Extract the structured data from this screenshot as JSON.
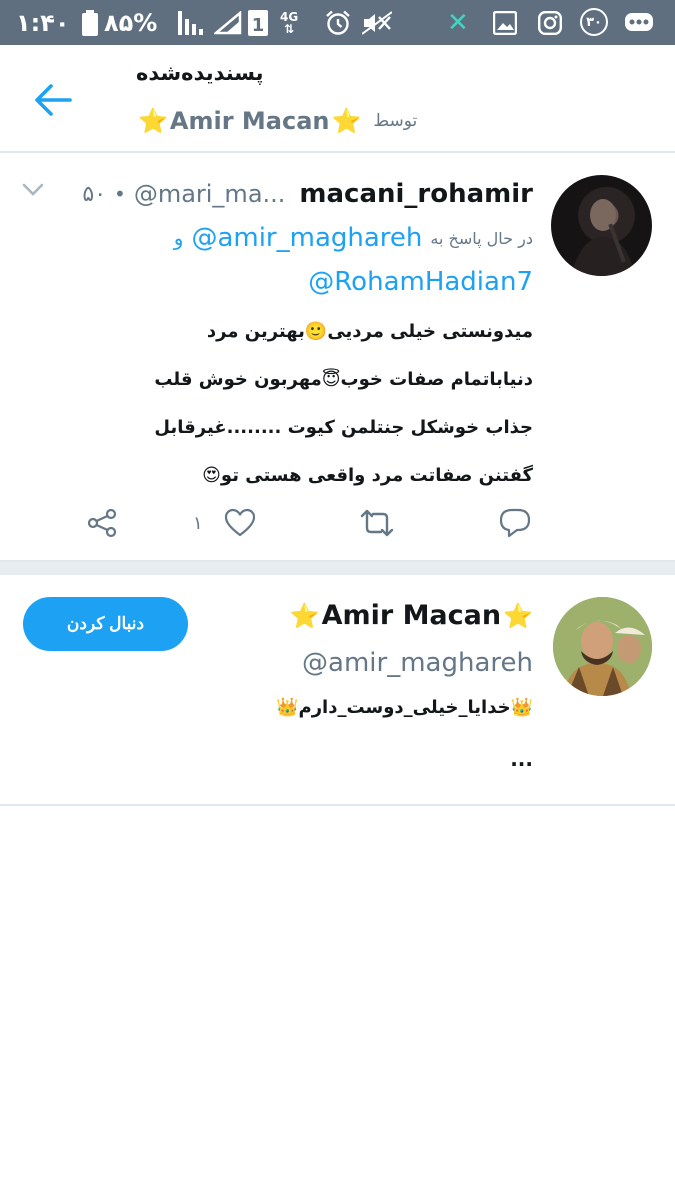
{
  "status_bar": {
    "time": "۱:۴۰",
    "battery": "۸۵%",
    "network": "4G",
    "sim": "1",
    "notification_count": "۳۰"
  },
  "header": {
    "title": "پسندیده‌شده",
    "by_label": "توسط",
    "owner_name": "Amir Macan"
  },
  "tweet": {
    "display_name": "macani_rohamir",
    "handle": "@mari_ma...",
    "time": "۵۰",
    "separator": "•",
    "replying_label": "در حال پاسخ به",
    "reply_to_1": "@amir_maghareh",
    "reply_and": "و",
    "reply_to_2": "@RohamHadian7",
    "body_lines": [
      "میدونستی خیلی مردیی🙂بهترین مرد",
      "دنیاباتمام صفات خوب😇مهربون خوش قلب",
      "جذاب خوشکل جنتلمن کیوت ........غیرقابل",
      "گفتنن صفاتت مرد واقعی هستی تو😍"
    ],
    "like_count": "۱"
  },
  "user_card": {
    "name": "Amir Macan",
    "handle": "@amir_maghareh",
    "bio": "👑خدایا_خیلی_دوست_دارم👑",
    "bio_more": "...",
    "follow_label": "دنبال کردن"
  },
  "colors": {
    "accent": "#1da1f2",
    "status_bar": "#5f6f80",
    "secondary_text": "#657786",
    "divider": "#e1e8ed",
    "star": "#f6b81a"
  },
  "icons": {
    "back": "arrow-left-icon",
    "chevron": "chevron-down-icon",
    "share": "share-icon",
    "like": "heart-icon",
    "retweet": "retweet-icon",
    "reply": "reply-icon"
  }
}
